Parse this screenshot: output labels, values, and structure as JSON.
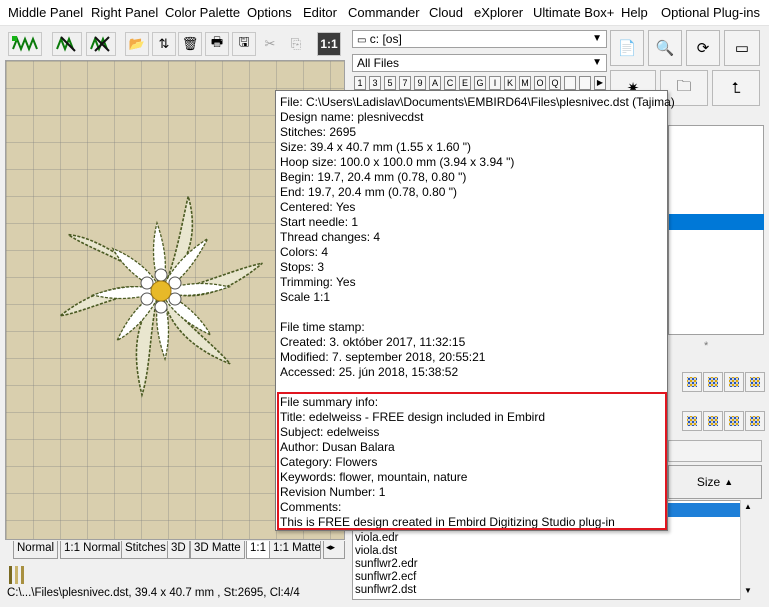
{
  "menu": [
    "Middle Panel",
    "Right Panel",
    "Color Palette",
    "Options",
    "Editor",
    "Commander",
    "Cloud",
    "eXplorer",
    "Ultimate Box+",
    "Help",
    "Optional Plug-ins"
  ],
  "toolbar": {
    "scale_label": "1:1"
  },
  "right": {
    "drive": "c: [os]",
    "filter": "All Files",
    "letters": [
      "1",
      "3",
      "5",
      "7",
      "9",
      "A",
      "C",
      "E",
      "G",
      "I",
      "K",
      "M",
      "O",
      "Q"
    ],
    "size_button": "Size",
    "asterisk": "*"
  },
  "tabs": [
    "Normal",
    "1:1 Normal",
    "Stitches",
    "3D",
    "3D Matte",
    "1:1",
    "1:1 Matte"
  ],
  "status": {
    "text": "C:\\...\\Files\\plesnivec.dst, 39.4 x 40.7 mm , St:2695, Cl:4/4"
  },
  "files": [
    "viola.edr",
    "viola.dst",
    "sunflwr2.edr",
    "sunflwr2.ecf",
    "sunflwr2.dst"
  ],
  "tooltip": {
    "lines": [
      "File: C:\\Users\\Ladislav\\Documents\\EMBIRD64\\Files\\plesnivec.dst (Tajima)",
      "Design name: plesnivecdst",
      "Stitches: 2695",
      "Size: 39.4 x 40.7 mm (1.55 x 1.60 \")",
      "Hoop size: 100.0 x 100.0 mm (3.94 x 3.94 \")",
      "Begin: 19.7, 20.4 mm (0.78, 0.80 \")",
      "End: 19.7, 20.4 mm (0.78, 0.80 \")",
      "Centered: Yes",
      "Start needle: 1",
      "Thread changes: 4",
      "Colors: 4",
      "Stops: 3",
      "Trimming: Yes",
      "Scale 1:1",
      "",
      "File time stamp:",
      "Created: 3. október 2017, 11:32:15",
      "Modified: 7. september 2018, 20:55:21",
      "Accessed: 25. jún 2018, 15:38:52",
      "",
      "File summary info:",
      "Title: edelweiss  - FREE design included in Embird",
      "Subject: edelweiss",
      "Author: Dusan Balara",
      "Category: Flowers",
      "Keywords: flower, mountain, nature",
      "Revision Number: 1",
      "Comments:",
      "This is FREE design created in Embird Digitizing Studio plug-in"
    ]
  },
  "colors": {
    "highlight_box": "#e0151f",
    "selection": "#0078d7",
    "canvas": "#d9cfae"
  }
}
